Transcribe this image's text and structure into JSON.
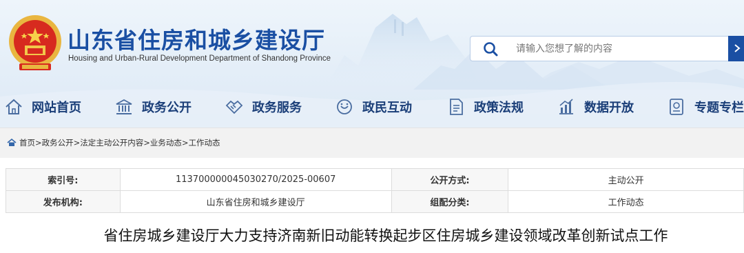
{
  "site": {
    "title": "山东省住房和城乡建设厅",
    "subtitle": "Housing and Urban-Rural Development Department of Shandong Province",
    "emblem_icon": "national-emblem-icon"
  },
  "search": {
    "placeholder": "请输入您想了解的内容",
    "value": "",
    "icon": "search-icon"
  },
  "nav": {
    "items": [
      {
        "label": "网站首页",
        "icon": "home-icon"
      },
      {
        "label": "政务公开",
        "icon": "building-icon"
      },
      {
        "label": "政务服务",
        "icon": "handshake-icon"
      },
      {
        "label": "政民互动",
        "icon": "chat-icon"
      },
      {
        "label": "政策法规",
        "icon": "document-icon"
      },
      {
        "label": "数据开放",
        "icon": "chart-icon"
      },
      {
        "label": "专题专栏",
        "icon": "topic-icon"
      }
    ]
  },
  "breadcrumb": {
    "items": [
      "首页",
      "政务公开",
      "法定主动公开内容",
      "业务动态",
      "工作动态"
    ],
    "separator": ">"
  },
  "meta": {
    "index_label": "索引号:",
    "index_value": "113700000045030270/2025-00607",
    "method_label": "公开方式:",
    "method_value": "主动公开",
    "publisher_label": "发布机构:",
    "publisher_value": "山东省住房和城乡建设厅",
    "category_label": "组配分类:",
    "category_value": "工作动态"
  },
  "article": {
    "title": "省住房城乡建设厅大力支持济南新旧动能转换起步区住房城乡建设领域改革创新试点工作"
  },
  "colors": {
    "brand_blue": "#1a4fa3",
    "nav_text": "#1a3e78",
    "header_bg": "#e4eef8"
  }
}
